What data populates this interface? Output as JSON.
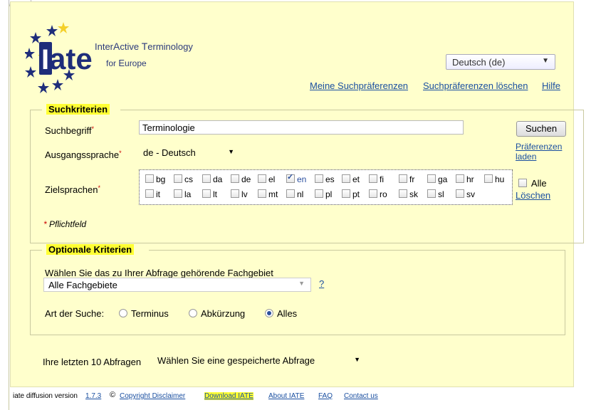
{
  "logo": {
    "brand": "iate",
    "line1_prefix": "Inter",
    "line1_a": "A",
    "line1_mid": "ctive ",
    "line1_t": "T",
    "line1_end": "erminology",
    "line2_prefix": "for ",
    "line2_e": "E",
    "line2_end": "urope"
  },
  "lang_select": {
    "value": "Deutsch (de)"
  },
  "top_links": {
    "preferences": "Meine Suchpräferenzen",
    "delete_preferences": "Suchpräferenzen löschen",
    "help": "Hilfe"
  },
  "search": {
    "legend": "Suchkriterien",
    "term_label": "Suchbegriff",
    "term_value": "Terminologie",
    "search_button": "Suchen",
    "source_label": "Ausgangssprache",
    "source_value": "de - Deutsch",
    "load_prefs_line1": "Präferenzen",
    "load_prefs_line2": "laden",
    "target_label": "Zielsprachen",
    "languages_row1": [
      "bg",
      "cs",
      "da",
      "de",
      "el",
      "en",
      "es",
      "et",
      "fi",
      "fr",
      "ga",
      "hr",
      "hu"
    ],
    "languages_row2": [
      "it",
      "la",
      "lt",
      "lv",
      "mt",
      "nl",
      "pl",
      "pt",
      "ro",
      "sk",
      "sl",
      "sv"
    ],
    "selected": "en",
    "all_label": "Alle",
    "clear_label": "Löschen",
    "required_mark": "*",
    "required_note": "Pflichtfeld"
  },
  "optional": {
    "legend": "Optionale Kriterien",
    "domain_label": "Wählen Sie das zu Ihrer Abfrage gehörende Fachgebiet",
    "domain_value": "Alle Fachgebiete",
    "help_link": "?",
    "search_type_label": "Art der Suche:",
    "search_types": [
      "Terminus",
      "Abkürzung",
      "Alles"
    ],
    "selected_type": "Alles"
  },
  "recent": {
    "label": "Ihre letzten 10 Abfragen",
    "value": "Wählen Sie eine gespeicherte Abfrage"
  },
  "footer": {
    "version_text": "iate diffusion version",
    "version": "1.7.3",
    "copyright_symbol": "©",
    "copyright": "Copyright Disclaimer",
    "download": "Download IATE",
    "about": "About IATE",
    "faq": "FAQ",
    "contact": "Contact us"
  },
  "colors": {
    "page_bg": "#ffffcc",
    "highlight": "#ffff33",
    "link": "#1a4fa0",
    "logo_blue": "#2c3a7c",
    "star": "#1e2d7a",
    "star_gold": "#f4d02a"
  }
}
